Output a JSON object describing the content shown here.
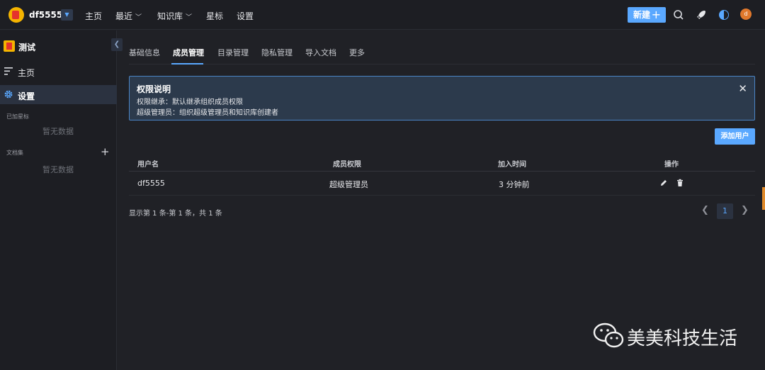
{
  "header": {
    "space_name": "df5555",
    "nav": [
      {
        "label": "主页",
        "has_dropdown": false
      },
      {
        "label": "最近",
        "has_dropdown": true
      },
      {
        "label": "知识库",
        "has_dropdown": true
      },
      {
        "label": "星标",
        "has_dropdown": false
      },
      {
        "label": "设置",
        "has_dropdown": false
      }
    ],
    "new_button": "新建",
    "avatar_initial": "d",
    "icons": [
      "search-icon",
      "rocket-icon",
      "theme-icon"
    ]
  },
  "sidebar": {
    "kb_title": "测试",
    "items": [
      {
        "label": "主页",
        "icon": "menu-icon"
      },
      {
        "label": "设置",
        "icon": "gear-icon",
        "active": true
      }
    ],
    "groups": [
      {
        "title": "已加星标",
        "empty": "暂无数据"
      },
      {
        "title": "文档集",
        "empty": "暂无数据"
      }
    ]
  },
  "tabs": [
    "基础信息",
    "成员管理",
    "目录管理",
    "隐私管理",
    "导入文档",
    "更多"
  ],
  "active_tab": "成员管理",
  "alert": {
    "title": "权限说明",
    "line1": "权限继承：默认继承组织成员权限",
    "line2": "超级管理员：组织超级管理员和知识库创建者"
  },
  "add_user_button": "添加用户",
  "table": {
    "columns": [
      "用户名",
      "成员权限",
      "加入时间",
      "操作"
    ],
    "rows": [
      {
        "username": "df5555",
        "role": "超级管理员",
        "joined": "3 分钟前"
      }
    ]
  },
  "pagination": {
    "summary": "显示第 1 条-第 1 条，共 1 条",
    "current_page": "1"
  },
  "watermark": "美美科技生活",
  "colors": {
    "accent": "#5aa8ff",
    "background": "#202126",
    "alert_bg": "#2c3a4c"
  }
}
